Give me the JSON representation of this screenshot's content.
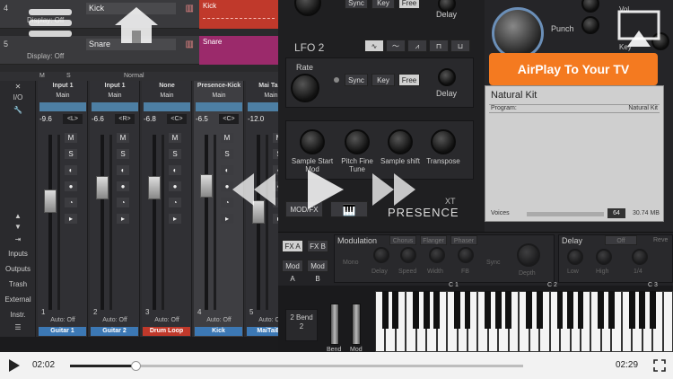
{
  "arrangement": {
    "tracks": [
      {
        "num": "4",
        "name": "Kick",
        "display": "Display: Off",
        "lane_label": "Kick",
        "lane_color": "#c0392b"
      },
      {
        "num": "5",
        "name": "Snare",
        "display": "Display: Off",
        "lane_label": "Snare",
        "lane_color": "#9b2a6b"
      }
    ]
  },
  "mixer_bar": {
    "m": "M",
    "s": "S",
    "mode": "Normal"
  },
  "mixer_side": {
    "io": "I/O",
    "inputs": "Inputs",
    "outputs": "Outputs",
    "trash": "Trash",
    "external": "External",
    "instr": "Instr."
  },
  "channels": [
    {
      "input": "Input 1",
      "output": "Main",
      "db": "-9.6",
      "pan": "<L>",
      "num": "1",
      "auto": "Auto: Off",
      "name": "Guitar 1",
      "name_color": "#3c78b4",
      "fader": 0.62
    },
    {
      "input": "Input 1",
      "output": "Main",
      "db": "-6.6",
      "pan": "<R>",
      "num": "2",
      "auto": "Auto: Off",
      "name": "Guitar 2",
      "name_color": "#3c78b4",
      "fader": 0.7
    },
    {
      "input": "None",
      "output": "Main",
      "db": "-6.8",
      "pan": "<C>",
      "num": "3",
      "auto": "Auto: Off",
      "name": "Drum Loop",
      "name_color": "#c0392b",
      "fader": 0.7
    },
    {
      "input": "Presence-Kick",
      "output": "Main",
      "db": "-6.5",
      "pan": "<C>",
      "num": "4",
      "auto": "Auto: Off",
      "name": "Kick",
      "name_color": "#3c78b4",
      "fader": 0.71,
      "selected": true
    },
    {
      "input": "Mai Tai -",
      "output": "Main",
      "db": "-12.0",
      "pan": "",
      "num": "5",
      "auto": "Auto: Off",
      "name": "MaiTaiBa",
      "name_color": "#3c78b4",
      "fader": 0.56
    }
  ],
  "channel_buttons": {
    "mute": "M",
    "solo": "S"
  },
  "synth": {
    "top": {
      "sync": "Sync",
      "key": "Key",
      "free": "Free",
      "delay": "Delay"
    },
    "lfo2": {
      "title": "LFO 2",
      "rate": "Rate",
      "sync": "Sync",
      "key": "Key",
      "free": "Free",
      "delay": "Delay"
    },
    "sample": {
      "knobs": [
        "Sample Start Mod",
        "Pitch Fine Tune",
        "Sample shift",
        "Transpose"
      ]
    },
    "modfx": "MOD/FX",
    "brand": "PRESENCE",
    "brand_suffix": "XT"
  },
  "right_panel": {
    "punch": "Punch",
    "vol": "Vol",
    "key": "Key",
    "kit_title": "Natural Kit",
    "program_label": "Program:",
    "program_value": "Natural Kit",
    "voices_label": "Voices",
    "voices_value": "64",
    "memory": "30.74 MB"
  },
  "modules": {
    "fxa": "FX A",
    "fxb": "FX B",
    "moda": "Mod A",
    "modb": "Mod B",
    "modulation_title": "Modulation",
    "mod_types": [
      "Chorus",
      "Flanger",
      "Phaser"
    ],
    "mod_knobs": [
      "Mono",
      "Delay",
      "Speed",
      "Width",
      "FB",
      "Sync",
      "Depth"
    ],
    "delay_title": "Delay",
    "delay_mode": "Off",
    "delay_reverb": "Reve",
    "delay_knobs": [
      "Low",
      "High",
      "1/4"
    ]
  },
  "keyboard": {
    "octaves": [
      "C 1",
      "C 2",
      "C 3"
    ],
    "bend_label": "2 Bend 2",
    "bend": "Bend",
    "mod": "Mod"
  },
  "overlay": {
    "airplay": "AirPlay To Your TV",
    "current_time": "02:02",
    "total_time": "02:29",
    "progress": 0.145
  }
}
